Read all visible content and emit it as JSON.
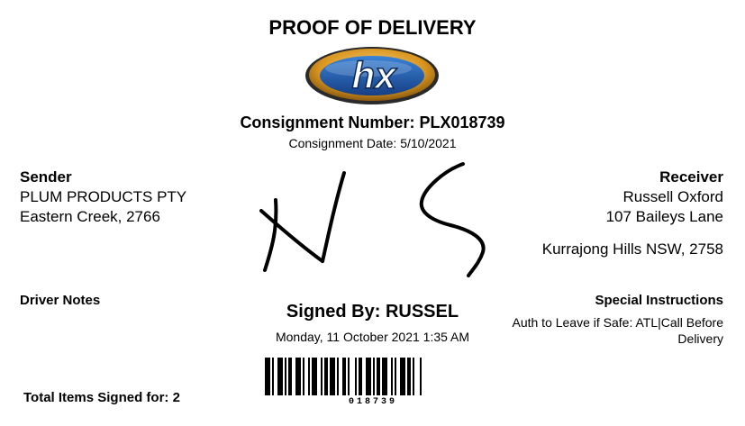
{
  "header": {
    "title": "PROOF OF DELIVERY",
    "logo_text": "hx",
    "consignment_number_label": "Consignment Number:",
    "consignment_number": "PLX018739",
    "consignment_date_label": "Consignment Date:",
    "consignment_date": "5/10/2021"
  },
  "sender": {
    "heading": "Sender",
    "name": "PLUM PRODUCTS PTY",
    "address": "Eastern Creek, 2766"
  },
  "receiver": {
    "heading": "Receiver",
    "name": "Russell Oxford",
    "street": "107 Baileys Lane",
    "locality": "Kurrajong Hills NSW, 2758"
  },
  "driver_notes": {
    "heading": "Driver Notes"
  },
  "special_instructions": {
    "heading": "Special Instructions",
    "text": "Auth to Leave if Safe: ATL|Call Before Delivery"
  },
  "signature": {
    "signed_by_label": "Signed By:",
    "signed_by": "RUSSEL",
    "signed_datetime": "Monday, 11 October 2021 1:35 AM"
  },
  "barcode": {
    "number": "018739"
  },
  "footer": {
    "total_items": "Total Items Signed for: 2"
  },
  "colors": {
    "logo_ring": "#c98a1b",
    "logo_blue": "#1f5fae",
    "ink": "#000000"
  }
}
